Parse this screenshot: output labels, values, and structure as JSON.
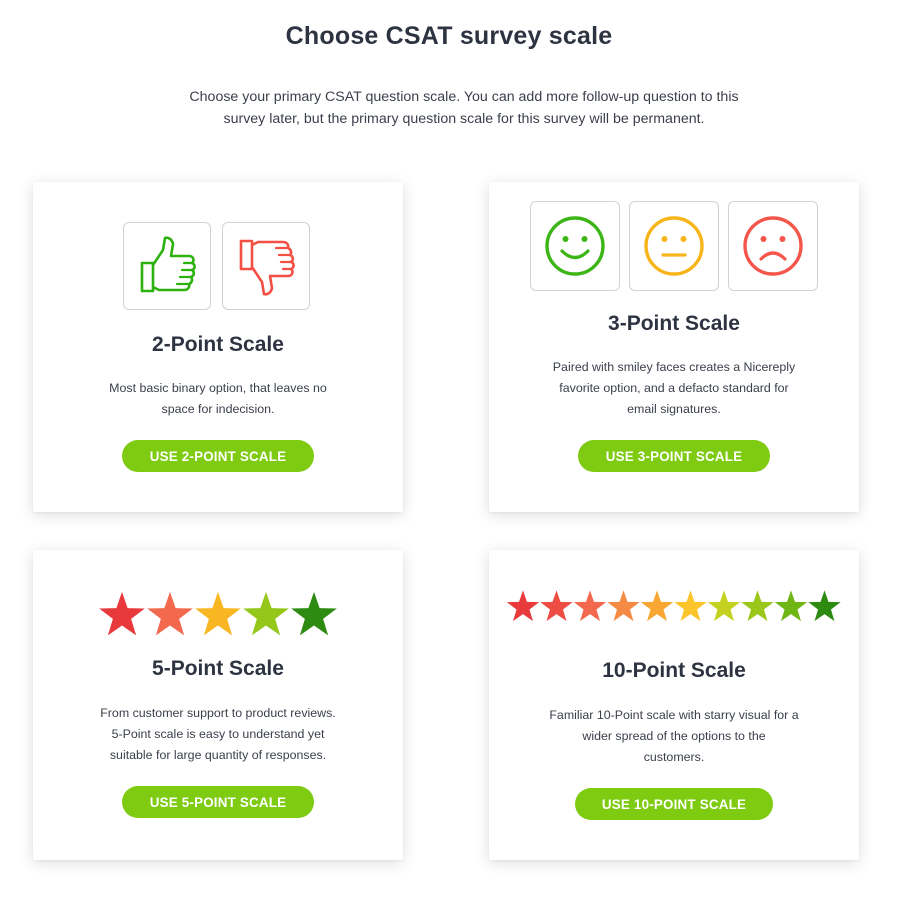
{
  "header": {
    "title": "Choose CSAT survey scale",
    "intro_line1": "Choose your primary CSAT question scale.  You can add more follow-up question to this",
    "intro_line2": "survey later, but the primary question scale for this survey will be permanent."
  },
  "cards": [
    {
      "title": "2-Point Scale",
      "desc_lines": [
        "Most basic binary option, that leaves no",
        "space for indecision."
      ],
      "button": "USE 2-POINT SCALE",
      "icons": [
        "thumbs-up-icon",
        "thumbs-down-icon"
      ],
      "icon_colors": [
        "#2db10f",
        "#f25045"
      ]
    },
    {
      "title": "3-Point Scale",
      "desc_lines": [
        "Paired with smiley faces creates a Nicereply",
        "favorite option, and a defacto standard for",
        "email signatures."
      ],
      "button": "USE 3-POINT SCALE",
      "icons": [
        "happy-face-icon",
        "neutral-face-icon",
        "sad-face-icon"
      ],
      "icon_colors": [
        "#3cb516",
        "#f7b51b",
        "#f5564b"
      ]
    },
    {
      "title": "5-Point Scale",
      "desc_lines": [
        "From customer support to product reviews.",
        "5-Point scale is easy to understand yet",
        "suitable for large quantity of responses."
      ],
      "button": "USE 5-POINT SCALE",
      "star_colors": [
        "#e8393c",
        "#f2694d",
        "#f8b623",
        "#94c719",
        "#2e8b12"
      ]
    },
    {
      "title": "10-Point Scale",
      "desc_lines": [
        "Familiar 10-Point scale with starry visual for a",
        "wider spread of the options to the",
        "customers."
      ],
      "button": "USE 10-POINT SCALE",
      "star_colors": [
        "#e8393c",
        "#ee4d43",
        "#f2694d",
        "#f58a45",
        "#f8a832",
        "#fcc52b",
        "#c4d120",
        "#9ac719",
        "#6fb514",
        "#2e8b12"
      ]
    }
  ],
  "accent_color": "#7ecb11"
}
